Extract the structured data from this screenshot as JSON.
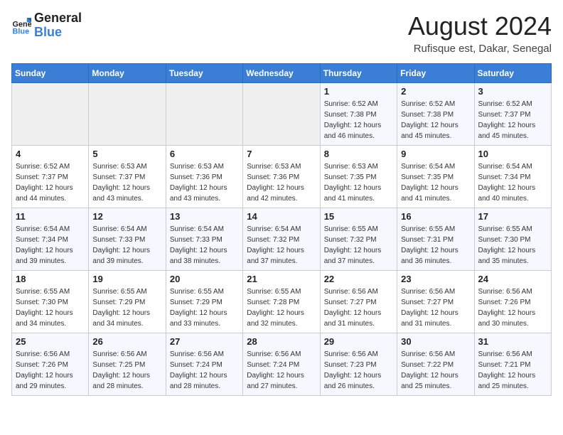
{
  "header": {
    "logo_general": "General",
    "logo_blue": "Blue",
    "month_year": "August 2024",
    "location": "Rufisque est, Dakar, Senegal"
  },
  "weekdays": [
    "Sunday",
    "Monday",
    "Tuesday",
    "Wednesday",
    "Thursday",
    "Friday",
    "Saturday"
  ],
  "weeks": [
    [
      {
        "day": "",
        "info": ""
      },
      {
        "day": "",
        "info": ""
      },
      {
        "day": "",
        "info": ""
      },
      {
        "day": "",
        "info": ""
      },
      {
        "day": "1",
        "info": "Sunrise: 6:52 AM\nSunset: 7:38 PM\nDaylight: 12 hours\nand 46 minutes."
      },
      {
        "day": "2",
        "info": "Sunrise: 6:52 AM\nSunset: 7:38 PM\nDaylight: 12 hours\nand 45 minutes."
      },
      {
        "day": "3",
        "info": "Sunrise: 6:52 AM\nSunset: 7:37 PM\nDaylight: 12 hours\nand 45 minutes."
      }
    ],
    [
      {
        "day": "4",
        "info": "Sunrise: 6:52 AM\nSunset: 7:37 PM\nDaylight: 12 hours\nand 44 minutes."
      },
      {
        "day": "5",
        "info": "Sunrise: 6:53 AM\nSunset: 7:37 PM\nDaylight: 12 hours\nand 43 minutes."
      },
      {
        "day": "6",
        "info": "Sunrise: 6:53 AM\nSunset: 7:36 PM\nDaylight: 12 hours\nand 43 minutes."
      },
      {
        "day": "7",
        "info": "Sunrise: 6:53 AM\nSunset: 7:36 PM\nDaylight: 12 hours\nand 42 minutes."
      },
      {
        "day": "8",
        "info": "Sunrise: 6:53 AM\nSunset: 7:35 PM\nDaylight: 12 hours\nand 41 minutes."
      },
      {
        "day": "9",
        "info": "Sunrise: 6:54 AM\nSunset: 7:35 PM\nDaylight: 12 hours\nand 41 minutes."
      },
      {
        "day": "10",
        "info": "Sunrise: 6:54 AM\nSunset: 7:34 PM\nDaylight: 12 hours\nand 40 minutes."
      }
    ],
    [
      {
        "day": "11",
        "info": "Sunrise: 6:54 AM\nSunset: 7:34 PM\nDaylight: 12 hours\nand 39 minutes."
      },
      {
        "day": "12",
        "info": "Sunrise: 6:54 AM\nSunset: 7:33 PM\nDaylight: 12 hours\nand 39 minutes."
      },
      {
        "day": "13",
        "info": "Sunrise: 6:54 AM\nSunset: 7:33 PM\nDaylight: 12 hours\nand 38 minutes."
      },
      {
        "day": "14",
        "info": "Sunrise: 6:54 AM\nSunset: 7:32 PM\nDaylight: 12 hours\nand 37 minutes."
      },
      {
        "day": "15",
        "info": "Sunrise: 6:55 AM\nSunset: 7:32 PM\nDaylight: 12 hours\nand 37 minutes."
      },
      {
        "day": "16",
        "info": "Sunrise: 6:55 AM\nSunset: 7:31 PM\nDaylight: 12 hours\nand 36 minutes."
      },
      {
        "day": "17",
        "info": "Sunrise: 6:55 AM\nSunset: 7:30 PM\nDaylight: 12 hours\nand 35 minutes."
      }
    ],
    [
      {
        "day": "18",
        "info": "Sunrise: 6:55 AM\nSunset: 7:30 PM\nDaylight: 12 hours\nand 34 minutes."
      },
      {
        "day": "19",
        "info": "Sunrise: 6:55 AM\nSunset: 7:29 PM\nDaylight: 12 hours\nand 34 minutes."
      },
      {
        "day": "20",
        "info": "Sunrise: 6:55 AM\nSunset: 7:29 PM\nDaylight: 12 hours\nand 33 minutes."
      },
      {
        "day": "21",
        "info": "Sunrise: 6:55 AM\nSunset: 7:28 PM\nDaylight: 12 hours\nand 32 minutes."
      },
      {
        "day": "22",
        "info": "Sunrise: 6:56 AM\nSunset: 7:27 PM\nDaylight: 12 hours\nand 31 minutes."
      },
      {
        "day": "23",
        "info": "Sunrise: 6:56 AM\nSunset: 7:27 PM\nDaylight: 12 hours\nand 31 minutes."
      },
      {
        "day": "24",
        "info": "Sunrise: 6:56 AM\nSunset: 7:26 PM\nDaylight: 12 hours\nand 30 minutes."
      }
    ],
    [
      {
        "day": "25",
        "info": "Sunrise: 6:56 AM\nSunset: 7:26 PM\nDaylight: 12 hours\nand 29 minutes."
      },
      {
        "day": "26",
        "info": "Sunrise: 6:56 AM\nSunset: 7:25 PM\nDaylight: 12 hours\nand 28 minutes."
      },
      {
        "day": "27",
        "info": "Sunrise: 6:56 AM\nSunset: 7:24 PM\nDaylight: 12 hours\nand 28 minutes."
      },
      {
        "day": "28",
        "info": "Sunrise: 6:56 AM\nSunset: 7:24 PM\nDaylight: 12 hours\nand 27 minutes."
      },
      {
        "day": "29",
        "info": "Sunrise: 6:56 AM\nSunset: 7:23 PM\nDaylight: 12 hours\nand 26 minutes."
      },
      {
        "day": "30",
        "info": "Sunrise: 6:56 AM\nSunset: 7:22 PM\nDaylight: 12 hours\nand 25 minutes."
      },
      {
        "day": "31",
        "info": "Sunrise: 6:56 AM\nSunset: 7:21 PM\nDaylight: 12 hours\nand 25 minutes."
      }
    ]
  ]
}
